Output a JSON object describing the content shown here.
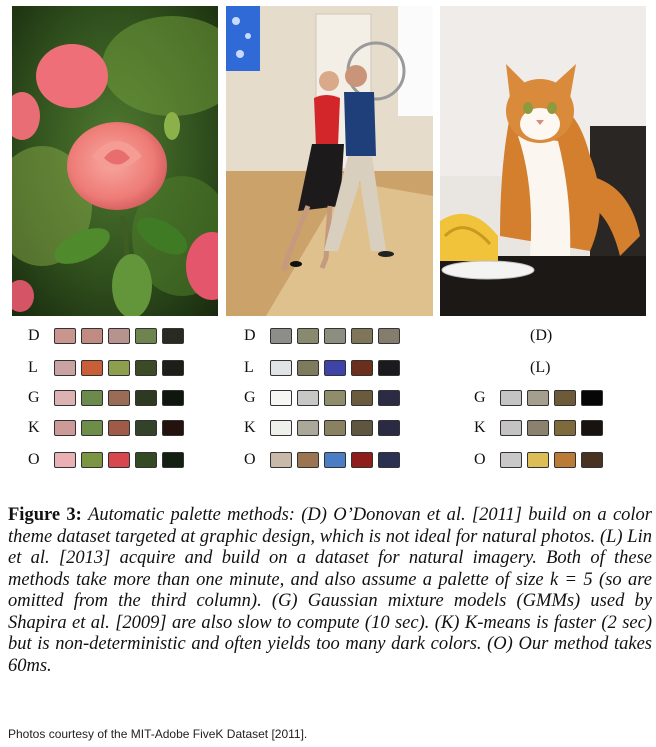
{
  "photos": [
    {
      "subject": "pink rose",
      "icon": "rose-photo"
    },
    {
      "subject": "dancing couple",
      "icon": "dancers-photo"
    },
    {
      "subject": "orange and white cat",
      "icon": "cat-photo"
    }
  ],
  "columns": [
    {
      "rows": [
        {
          "label": "D",
          "colors": [
            "#c9958f",
            "#c18a82",
            "#b79390",
            "#6e8450",
            "#272b21"
          ]
        },
        {
          "label": "L",
          "colors": [
            "#c9a3a2",
            "#c85f38",
            "#8d9f4e",
            "#3c4a25",
            "#1c1e17"
          ]
        },
        {
          "label": "G",
          "colors": [
            "#dcb3b2",
            "#6b8a4b",
            "#9a6b55",
            "#2d3a21",
            "#0e160d"
          ]
        },
        {
          "label": "K",
          "colors": [
            "#cc9b98",
            "#6d8d48",
            "#9f5a48",
            "#33432a",
            "#24120c"
          ]
        },
        {
          "label": "O",
          "colors": [
            "#eab1b4",
            "#7c9543",
            "#d8474d",
            "#344a24",
            "#142112"
          ]
        }
      ]
    },
    {
      "rows": [
        {
          "label": "D",
          "colors": [
            "#8d8e8c",
            "#878a6d",
            "#8d8d80",
            "#7f7558",
            "#857c6e"
          ]
        },
        {
          "label": "L",
          "colors": [
            "#dfe3e6",
            "#7d7b5c",
            "#3e44a7",
            "#6b2f1e",
            "#1b1a1d"
          ]
        },
        {
          "label": "G",
          "colors": [
            "#f6f6f4",
            "#c7c8c6",
            "#8f8d6c",
            "#6b5b3e",
            "#2c2b45"
          ]
        },
        {
          "label": "K",
          "colors": [
            "#eef0ec",
            "#a9a899",
            "#8a8163",
            "#5f563f",
            "#2b2a44"
          ]
        },
        {
          "label": "O",
          "colors": [
            "#c8b9a8",
            "#9b7551",
            "#4a7dc5",
            "#8f1d1c",
            "#2b3150"
          ]
        }
      ]
    },
    {
      "rows": [
        {
          "label": "(D)",
          "colors": []
        },
        {
          "label": "(L)",
          "colors": []
        },
        {
          "label": "G",
          "colors": [
            "#c6c3c4",
            "#a49e8f",
            "#6d5a39",
            "#060606"
          ]
        },
        {
          "label": "K",
          "colors": [
            "#c4c2c3",
            "#8b816f",
            "#7e6a3a",
            "#18130f"
          ]
        },
        {
          "label": "O",
          "colors": [
            "#cac7c9",
            "#ddbd55",
            "#b97b36",
            "#4a3222"
          ]
        }
      ]
    }
  ],
  "caption": {
    "label": "Figure 3:",
    "text": "Automatic palette methods: (D) O’Donovan et al. [2011] build on a color theme dataset targeted at graphic design, which is not ideal for natural photos. (L) Lin et al. [2013] acquire and build on a dataset for natural imagery. Both of these methods take more than one minute, and also assume a palette of size k = 5 (so are omitted from the third column). (G) Gaussian mixture models (GMMs) used by Shapira et al. [2009] are also slow to compute (10 sec). (K) K-means is faster (2 sec) but is non-deterministic and often yields too many dark colors. (O) Our method takes 60ms.",
    "credit": "Photos courtesy of the MIT-Adobe FiveK Dataset [2011]."
  }
}
